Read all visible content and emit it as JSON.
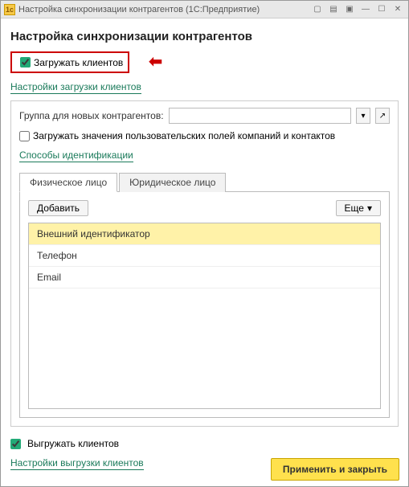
{
  "window": {
    "title": "Настройка синхронизации контрагентов (1С:Предприятие)"
  },
  "page_title": "Настройка синхронизации контрагентов",
  "load_clients": {
    "checkbox_label": "Загружать клиентов",
    "checked": true
  },
  "load_settings_link": "Настройки загрузки клиентов",
  "group_field": {
    "label": "Группа для новых контрагентов:",
    "value": ""
  },
  "load_custom_fields": {
    "checkbox_label": "Загружать значения пользовательских полей компаний и контактов",
    "checked": false
  },
  "id_methods_link": "Способы идентификации",
  "tabs": [
    {
      "label": "Физическое лицо",
      "active": true
    },
    {
      "label": "Юридическое лицо",
      "active": false
    }
  ],
  "toolbar": {
    "add_label": "Добавить",
    "more_label": "Еще"
  },
  "list_items": [
    {
      "label": "Внешний идентификатор",
      "selected": true
    },
    {
      "label": "Телефон",
      "selected": false
    },
    {
      "label": "Email",
      "selected": false
    }
  ],
  "export_clients": {
    "checkbox_label": "Выгружать клиентов",
    "checked": true
  },
  "export_settings_link": "Настройки выгрузки клиентов",
  "apply_button": "Применить и закрыть"
}
